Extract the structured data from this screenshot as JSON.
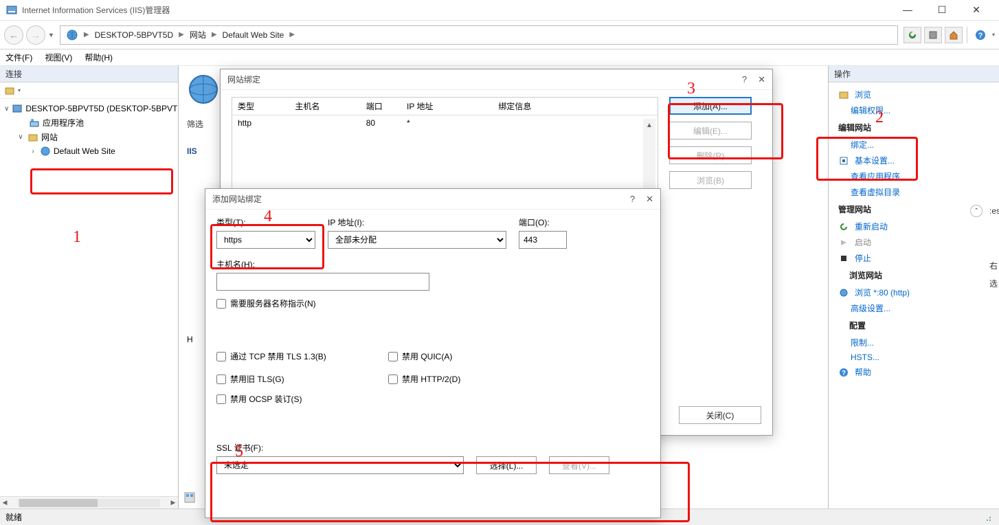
{
  "window": {
    "title": "Internet Information Services (IIS)管理器"
  },
  "breadcrumb": {
    "node1": "DESKTOP-5BPVT5D",
    "node2": "网站",
    "node3": "Default Web Site"
  },
  "menu": {
    "file": "文件(F)",
    "view": "视图(V)",
    "help": "帮助(H)"
  },
  "connections": {
    "title": "连接",
    "server": "DESKTOP-5BPVT5D (DESKTOP-5BPVT5D)",
    "apppool": "应用程序池",
    "sites": "网站",
    "default_site": "Default Web Site"
  },
  "actions": {
    "title": "操作",
    "browse": "浏览",
    "edit_perm": "编辑权限...",
    "edit_site": "编辑网站",
    "bindings": "绑定...",
    "basic": "基本设置...",
    "view_apps": "查看应用程序",
    "view_vdir": "查看虚拟目录",
    "manage_site": "管理网站",
    "restart": "重新启动",
    "start": "启动",
    "stop": "停止",
    "browse_site_hdr": "浏览网站",
    "browse80": "浏览 *:80 (http)",
    "advanced": "高级设置...",
    "config": "配置",
    "limits": "限制...",
    "hsts": "HSTS...",
    "help": "帮助"
  },
  "statusbar": {
    "ready": "就绪"
  },
  "center": {
    "filter_frag": "筛选",
    "iis_frag": "IIS",
    "h_frag": "H"
  },
  "bindings_dialog": {
    "title": "网站绑定",
    "cols": {
      "type": "类型",
      "host": "主机名",
      "port": "端口",
      "ip": "IP 地址",
      "info": "绑定信息"
    },
    "row0": {
      "type": "http",
      "host": "",
      "port": "80",
      "ip": "*"
    },
    "buttons": {
      "add": "添加(A)...",
      "edit": "编辑(E)...",
      "remove": "删除(R)",
      "browse": "浏览(B)",
      "close": "关闭(C)"
    }
  },
  "addbinding_dialog": {
    "title": "添加网站绑定",
    "labels": {
      "type": "类型(T):",
      "ip": "IP 地址(I):",
      "port": "端口(O):",
      "host": "主机名(H):",
      "ssl": "SSL 证书(F):"
    },
    "values": {
      "type": "https",
      "ip": "全部未分配",
      "port": "443",
      "host": "",
      "ssl": "未选定"
    },
    "checkboxes": {
      "sni": "需要服务器名称指示(N)",
      "tls13": "通过 TCP 禁用 TLS 1.3(B)",
      "quic": "禁用 QUIC(A)",
      "oldtls": "禁用旧 TLS(G)",
      "http2": "禁用 HTTP/2(D)",
      "ocsp": "禁用 OCSP 装订(S)"
    },
    "buttons": {
      "select": "选择(L)...",
      "view": "查看(V)..."
    }
  },
  "annotations": {
    "n1": "1",
    "n2": "2",
    "n3": "3",
    "n4": "4",
    "n5": "5"
  }
}
